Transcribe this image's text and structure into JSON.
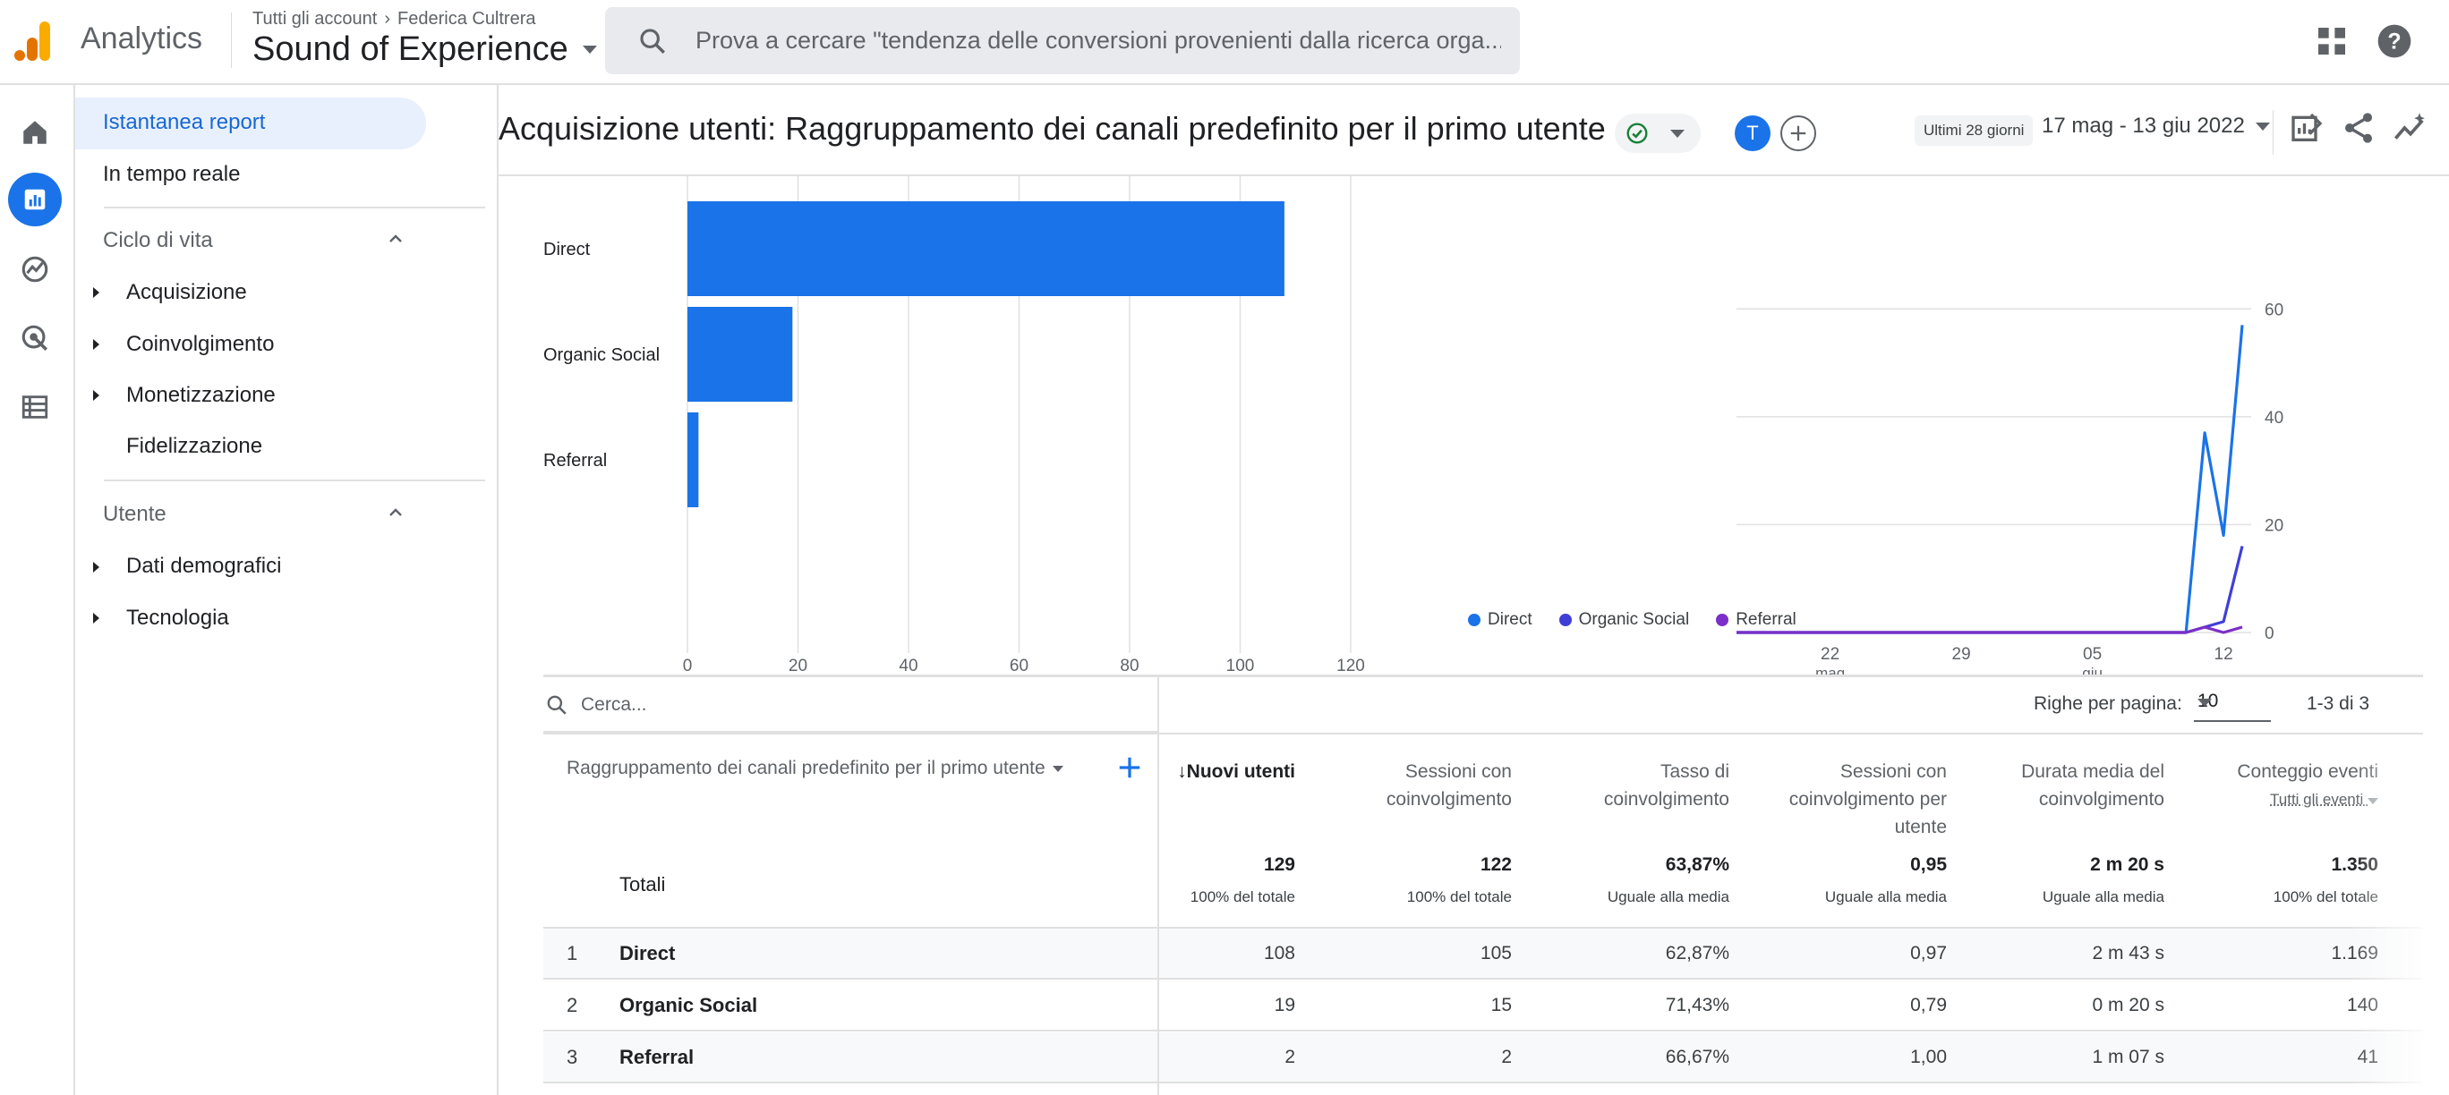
{
  "app": {
    "name": "Analytics",
    "breadcrumb": [
      "Tutti gli account",
      "Federica Cultrera"
    ],
    "property": "Sound of Experience",
    "search_placeholder": "Prova a cercare \"tendenza delle conversioni provenienti dalla ricerca orga..."
  },
  "icons": {
    "search": "search-icon",
    "apps": "apps-grid-icon",
    "help": "help-icon",
    "rail": [
      "home-icon",
      "reports-icon",
      "explore-icon",
      "advertising-icon",
      "configure-icon"
    ]
  },
  "sidebar": {
    "items_top": [
      "Istantanea report",
      "In tempo reale"
    ],
    "sections": [
      {
        "title": "Ciclo di vita",
        "items": [
          "Acquisizione",
          "Coinvolgimento",
          "Monetizzazione",
          "Fidelizzazione"
        ]
      },
      {
        "title": "Utente",
        "items": [
          "Dati demografici",
          "Tecnologia"
        ]
      }
    ]
  },
  "header": {
    "title": "Acquisizione utenti: Raggruppamento dei canali predefinito per il primo utente",
    "avatar_letter": "T",
    "date_badge": "Ultimi 28 giorni",
    "date_range": "17 mag - 13 giu 2022"
  },
  "colors": {
    "accent": "#1a73e8",
    "direct": "#1a73e8",
    "organic_social": "#3f3fd8",
    "referral": "#7b2fc8"
  },
  "chart_data": [
    {
      "type": "bar",
      "orientation": "horizontal",
      "categories": [
        "Direct",
        "Organic Social",
        "Referral"
      ],
      "values": [
        108,
        19,
        2
      ],
      "xticks": [
        "0",
        "20",
        "40",
        "60",
        "80",
        "100",
        "120"
      ],
      "xlim": [
        0,
        120
      ],
      "grid": true
    },
    {
      "type": "line",
      "x": [
        "17 mag",
        "18 mag",
        "19 mag",
        "20 mag",
        "21 mag",
        "22 mag",
        "23 mag",
        "24 mag",
        "25 mag",
        "26 mag",
        "27 mag",
        "28 mag",
        "29 mag",
        "30 mag",
        "31 mag",
        "1 giu",
        "2 giu",
        "3 giu",
        "4 giu",
        "5 giu",
        "6 giu",
        "7 giu",
        "8 giu",
        "9 giu",
        "10 giu",
        "11 giu",
        "12 giu",
        "13 giu"
      ],
      "xticks": [
        {
          "label": "22",
          "sub": "mag",
          "at": "22 mag"
        },
        {
          "label": "29",
          "at": "29 mag"
        },
        {
          "label": "05",
          "sub": "giu",
          "at": "5 giu"
        },
        {
          "label": "12",
          "at": "12 giu"
        }
      ],
      "yticks": [
        "0",
        "20",
        "40",
        "60"
      ],
      "ylim": [
        0,
        70
      ],
      "axis_side": "right",
      "series": [
        {
          "name": "Direct",
          "values": [
            0,
            0,
            0,
            0,
            0,
            0,
            0,
            0,
            0,
            0,
            0,
            0,
            0,
            0,
            0,
            0,
            0,
            0,
            0,
            0,
            0,
            0,
            0,
            0,
            0,
            37,
            18,
            57
          ]
        },
        {
          "name": "Organic Social",
          "values": [
            0,
            0,
            0,
            0,
            0,
            0,
            0,
            0,
            0,
            0,
            0,
            0,
            0,
            0,
            0,
            0,
            0,
            0,
            0,
            0,
            0,
            0,
            0,
            0,
            0,
            1,
            2,
            16
          ]
        },
        {
          "name": "Referral",
          "values": [
            0,
            0,
            0,
            0,
            0,
            0,
            0,
            0,
            0,
            0,
            0,
            0,
            0,
            0,
            0,
            0,
            0,
            0,
            0,
            0,
            0,
            0,
            0,
            0,
            0,
            1,
            0,
            1
          ]
        }
      ],
      "legend": "bottom-left",
      "grid": true
    }
  ],
  "table": {
    "search_placeholder": "Cerca...",
    "rows_per_page_label": "Righe per pagina:",
    "rows_per_page": "10",
    "pagination": "1-3 di 3",
    "dimension_header": "Raggruppamento dei canali predefinito per il primo utente",
    "columns": [
      {
        "label": "↓Nuovi utenti",
        "sorted": true
      },
      {
        "label": "Sessioni con coinvolgimento"
      },
      {
        "label": "Tasso di coinvolgimento"
      },
      {
        "label": "Sessioni con coinvolgimento per utente"
      },
      {
        "label": "Durata media del coinvolgimento"
      },
      {
        "label": "Conteggio eventi",
        "sub": "Tutti gli eventi"
      }
    ],
    "totals": {
      "label": "Totali",
      "values": [
        "129",
        "122",
        "63,87%",
        "0,95",
        "2 m 20 s",
        "1.350"
      ],
      "subs": [
        "100% del totale",
        "100% del totale",
        "Uguale alla media",
        "Uguale alla media",
        "Uguale alla media",
        "100% del totale"
      ]
    },
    "rows": [
      {
        "index": "1",
        "name": "Direct",
        "values": [
          "108",
          "105",
          "62,87%",
          "0,97",
          "2 m 43 s",
          "1.169"
        ]
      },
      {
        "index": "2",
        "name": "Organic Social",
        "values": [
          "19",
          "15",
          "71,43%",
          "0,79",
          "0 m 20 s",
          "140"
        ]
      },
      {
        "index": "3",
        "name": "Referral",
        "values": [
          "2",
          "2",
          "66,67%",
          "1,00",
          "1 m 07 s",
          "41"
        ]
      }
    ]
  }
}
